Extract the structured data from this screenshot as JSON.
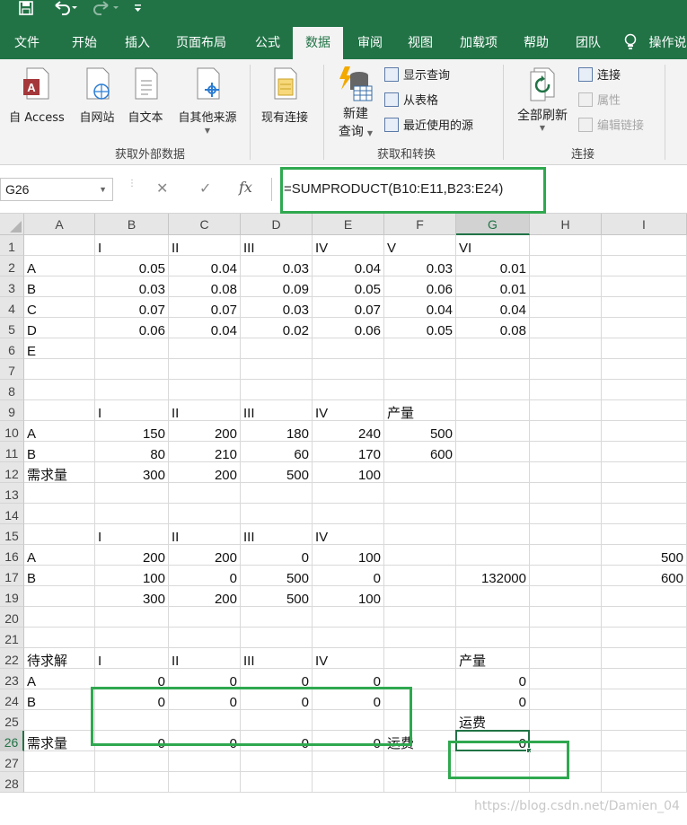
{
  "quick_access": {
    "save_icon": "save-icon",
    "undo_icon": "undo-icon",
    "redo_icon": "redo-icon",
    "customize_icon": "customize-icon"
  },
  "tabs": [
    "文件",
    "开始",
    "插入",
    "页面布局",
    "公式",
    "数据",
    "审阅",
    "视图",
    "加载项",
    "帮助",
    "团队"
  ],
  "active_tab": "数据",
  "tell_me": "操作说",
  "ribbon": {
    "get_external": {
      "label": "获取外部数据",
      "items": [
        "自 Access",
        "自网站",
        "自文本",
        "自其他来源",
        "现有连接"
      ]
    },
    "get_transform": {
      "label": "获取和转换",
      "new_query_l1": "新建",
      "new_query_l2": "查询",
      "show_query": "显示查询",
      "from_table": "从表格",
      "recent_sources": "最近使用的源"
    },
    "connections": {
      "label": "连接",
      "refresh_all": "全部刷新",
      "connections": "连接",
      "properties": "属性",
      "edit_links": "编辑链接"
    }
  },
  "formula_bar": {
    "name_box": "G26",
    "formula": "=SUMPRODUCT(B10:E11,B23:E24)"
  },
  "columns": [
    "A",
    "B",
    "C",
    "D",
    "E",
    "F",
    "G",
    "H",
    "I"
  ],
  "selected_column": "G",
  "selected_row": "26",
  "rows": [
    {
      "num": "1",
      "cells": [
        "",
        "I",
        "II",
        "III",
        "IV",
        "V",
        "VI",
        "",
        ""
      ]
    },
    {
      "num": "2",
      "cells": [
        "A",
        "0.05",
        "0.04",
        "0.03",
        "0.04",
        "0.03",
        "0.01",
        "",
        ""
      ]
    },
    {
      "num": "3",
      "cells": [
        "B",
        "0.03",
        "0.08",
        "0.09",
        "0.05",
        "0.06",
        "0.01",
        "",
        ""
      ]
    },
    {
      "num": "4",
      "cells": [
        "C",
        "0.07",
        "0.07",
        "0.03",
        "0.07",
        "0.04",
        "0.04",
        "",
        ""
      ]
    },
    {
      "num": "5",
      "cells": [
        "D",
        "0.06",
        "0.04",
        "0.02",
        "0.06",
        "0.05",
        "0.08",
        "",
        ""
      ]
    },
    {
      "num": "6",
      "cells": [
        "E",
        "",
        "",
        "",
        "",
        "",
        "",
        "",
        ""
      ]
    },
    {
      "num": "7",
      "cells": [
        "",
        "",
        "",
        "",
        "",
        "",
        "",
        "",
        ""
      ]
    },
    {
      "num": "8",
      "cells": [
        "",
        "",
        "",
        "",
        "",
        "",
        "",
        "",
        ""
      ]
    },
    {
      "num": "9",
      "cells": [
        "",
        "I",
        "II",
        "III",
        "IV",
        "产量",
        "",
        "",
        ""
      ]
    },
    {
      "num": "10",
      "cells": [
        "A",
        "150",
        "200",
        "180",
        "240",
        "500",
        "",
        "",
        ""
      ]
    },
    {
      "num": "11",
      "cells": [
        "B",
        "80",
        "210",
        "60",
        "170",
        "600",
        "",
        "",
        ""
      ]
    },
    {
      "num": "12",
      "cells": [
        "需求量",
        "300",
        "200",
        "500",
        "100",
        "",
        "",
        "",
        ""
      ]
    },
    {
      "num": "13",
      "cells": [
        "",
        "",
        "",
        "",
        "",
        "",
        "",
        "",
        ""
      ]
    },
    {
      "num": "14",
      "cells": [
        "",
        "",
        "",
        "",
        "",
        "",
        "",
        "",
        ""
      ]
    },
    {
      "num": "15",
      "cells": [
        "",
        "I",
        "II",
        "III",
        "IV",
        "",
        "",
        "",
        ""
      ]
    },
    {
      "num": "16",
      "cells": [
        "A",
        "200",
        "200",
        "0",
        "100",
        "",
        "",
        "",
        "500"
      ]
    },
    {
      "num": "17",
      "cells": [
        "B",
        "100",
        "0",
        "500",
        "0",
        "",
        "132000",
        "",
        "600"
      ]
    },
    {
      "num": "19",
      "cells": [
        "",
        "300",
        "200",
        "500",
        "100",
        "",
        "",
        "",
        ""
      ]
    },
    {
      "num": "20",
      "cells": [
        "",
        "",
        "",
        "",
        "",
        "",
        "",
        "",
        ""
      ]
    },
    {
      "num": "21",
      "cells": [
        "",
        "",
        "",
        "",
        "",
        "",
        "",
        "",
        ""
      ]
    },
    {
      "num": "22",
      "cells": [
        "待求解",
        "I",
        "II",
        "III",
        "IV",
        "",
        "产量",
        "",
        ""
      ]
    },
    {
      "num": "23",
      "cells": [
        "A",
        "0",
        "0",
        "0",
        "0",
        "",
        "0",
        "",
        ""
      ]
    },
    {
      "num": "24",
      "cells": [
        "B",
        "0",
        "0",
        "0",
        "0",
        "",
        "0",
        "",
        ""
      ]
    },
    {
      "num": "25",
      "cells": [
        "",
        "",
        "",
        "",
        "",
        "",
        "运费",
        "",
        ""
      ]
    },
    {
      "num": "26",
      "cells": [
        "需求量",
        "0",
        "0",
        "0",
        "0",
        "运费",
        "0",
        "",
        ""
      ]
    },
    {
      "num": "27",
      "cells": [
        "",
        "",
        "",
        "",
        "",
        "",
        "",
        "",
        ""
      ]
    },
    {
      "num": "28",
      "cells": [
        "",
        "",
        "",
        "",
        "",
        "",
        "",
        "",
        ""
      ]
    }
  ],
  "watermark": "https://blog.csdn.net/Damien_04"
}
